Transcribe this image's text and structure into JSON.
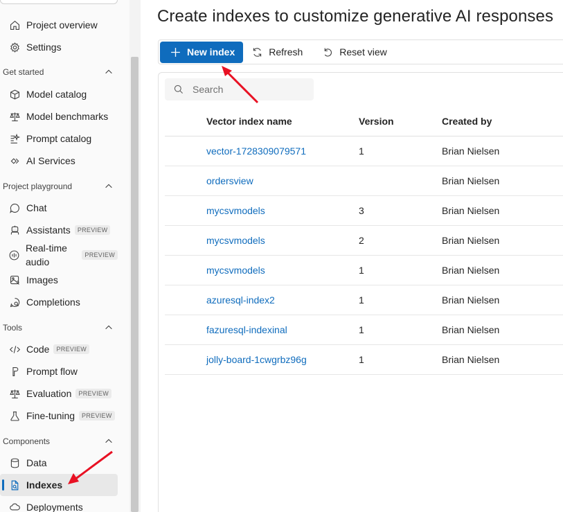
{
  "sidebar": {
    "top_items": [
      {
        "label": "Project overview",
        "icon": "home-icon"
      },
      {
        "label": "Settings",
        "icon": "gear-icon"
      }
    ],
    "sections": [
      {
        "title": "Get started",
        "items": [
          {
            "label": "Model catalog",
            "icon": "cube-icon"
          },
          {
            "label": "Model benchmarks",
            "icon": "scale-icon"
          },
          {
            "label": "Prompt catalog",
            "icon": "prompt-icon"
          },
          {
            "label": "AI Services",
            "icon": "link-icon"
          }
        ]
      },
      {
        "title": "Project playground",
        "items": [
          {
            "label": "Chat",
            "icon": "chat-icon"
          },
          {
            "label": "Assistants",
            "icon": "bot-icon",
            "badge": "PREVIEW"
          },
          {
            "label": "Real-time audio",
            "icon": "audio-icon",
            "badge": "PREVIEW"
          },
          {
            "label": "Images",
            "icon": "image-icon"
          },
          {
            "label": "Completions",
            "icon": "completions-icon"
          }
        ]
      },
      {
        "title": "Tools",
        "items": [
          {
            "label": "Code",
            "icon": "code-icon",
            "badge": "PREVIEW"
          },
          {
            "label": "Prompt flow",
            "icon": "flow-icon"
          },
          {
            "label": "Evaluation",
            "icon": "scale-icon",
            "badge": "PREVIEW"
          },
          {
            "label": "Fine-tuning",
            "icon": "flask-icon",
            "badge": "PREVIEW"
          }
        ]
      },
      {
        "title": "Components",
        "items": [
          {
            "label": "Data",
            "icon": "database-icon"
          },
          {
            "label": "Indexes",
            "icon": "index-icon",
            "active": true
          },
          {
            "label": "Deployments",
            "icon": "cloud-icon"
          }
        ]
      }
    ]
  },
  "main": {
    "title": "Create indexes to customize generative AI responses",
    "toolbar": {
      "new_index_label": "New index",
      "refresh_label": "Refresh",
      "reset_view_label": "Reset view"
    },
    "search": {
      "placeholder": "Search"
    },
    "table": {
      "columns": [
        "Vector index name",
        "Version",
        "Created by"
      ],
      "rows": [
        {
          "name": "vector-1728309079571",
          "version": "1",
          "created_by": "Brian Nielsen"
        },
        {
          "name": "ordersview",
          "version": "",
          "created_by": "Brian Nielsen"
        },
        {
          "name": "mycsvmodels",
          "version": "3",
          "created_by": "Brian Nielsen"
        },
        {
          "name": "mycsvmodels",
          "version": "2",
          "created_by": "Brian Nielsen"
        },
        {
          "name": "mycsvmodels",
          "version": "1",
          "created_by": "Brian Nielsen"
        },
        {
          "name": "azuresql-index2",
          "version": "1",
          "created_by": "Brian Nielsen"
        },
        {
          "name": "fazuresql-indexinal",
          "version": "1",
          "created_by": "Brian Nielsen"
        },
        {
          "name": "jolly-board-1cwgrbz96g",
          "version": "1",
          "created_by": "Brian Nielsen"
        }
      ]
    }
  },
  "colors": {
    "accent": "#0f6cbd",
    "annotation_arrow": "#e81123"
  }
}
